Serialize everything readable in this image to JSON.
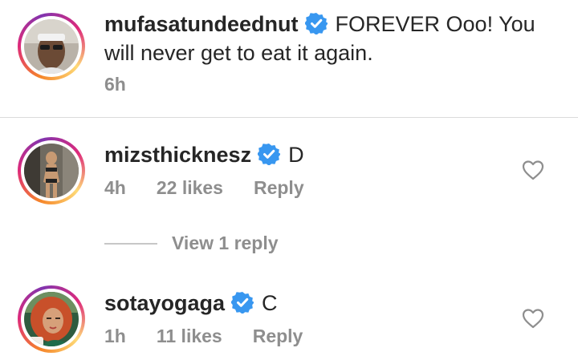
{
  "caption": {
    "username": "mufasatundeednut",
    "text_line1": "FOREVER Ooo! You",
    "text_line2": "will never get to eat it again.",
    "time": "6h"
  },
  "comments": [
    {
      "username": "mizsthicknesz",
      "text": "D",
      "time": "4h",
      "likes": "22 likes",
      "reply_label": "Reply"
    },
    {
      "username": "sotayogaga",
      "text": "C",
      "time": "1h",
      "likes": "11 likes",
      "reply_label": "Reply"
    }
  ],
  "view_replies": "View 1 reply",
  "colors": {
    "verified_badge": "#3897f0",
    "meta_text": "#8e8e8e",
    "story_ring": [
      "#f58529",
      "#dd2a7b",
      "#8134af"
    ]
  },
  "icons": [
    "verified-badge-icon",
    "heart-outline-icon"
  ]
}
